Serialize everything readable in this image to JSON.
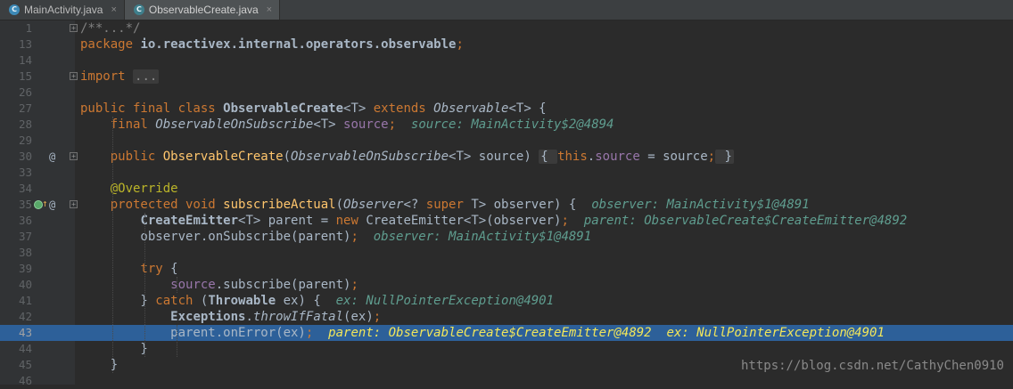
{
  "tabs": [
    {
      "label": "MainActivity.java",
      "icon": "c-class-icon",
      "close": "×",
      "active": false
    },
    {
      "label": "ObservableCreate.java",
      "icon": "c-class-icon",
      "close": "×",
      "active": true
    }
  ],
  "tab_icon_letter": "C",
  "lines": [
    {
      "n": "1",
      "tokens": [
        {
          "t": "/**...*/",
          "c": "cmt"
        }
      ]
    },
    {
      "n": "13",
      "tokens": [
        {
          "t": "package ",
          "c": "kw"
        },
        {
          "t": "io.reactivex.internal.operators.observable",
          "c": "bold"
        },
        {
          "t": ";",
          "c": "kw"
        }
      ]
    },
    {
      "n": "14",
      "tokens": []
    },
    {
      "n": "15",
      "tokens": [
        {
          "t": "import ",
          "c": "kw"
        },
        {
          "t": "...",
          "c": "fold-inline dim"
        }
      ]
    },
    {
      "n": "26",
      "tokens": []
    },
    {
      "n": "27",
      "tokens": [
        {
          "t": "public final class ",
          "c": "kw"
        },
        {
          "t": "ObservableCreate",
          "c": "bold"
        },
        {
          "t": "<T> "
        },
        {
          "t": "extends ",
          "c": "kw"
        },
        {
          "t": "Observable",
          "c": "it"
        },
        {
          "t": "<T> {"
        }
      ]
    },
    {
      "n": "28",
      "tokens": [
        {
          "t": "    "
        },
        {
          "t": "final ",
          "c": "kw"
        },
        {
          "t": "ObservableOnSubscribe",
          "c": "it"
        },
        {
          "t": "<T> "
        },
        {
          "t": "source",
          "c": "fld"
        },
        {
          "t": ";",
          "c": "kw"
        },
        {
          "t": "  source: MainActivity$2@4894",
          "c": "dbg"
        }
      ]
    },
    {
      "n": "29",
      "tokens": []
    },
    {
      "n": "30",
      "tokens": [
        {
          "t": "    "
        },
        {
          "t": "public ",
          "c": "kw"
        },
        {
          "t": "ObservableCreate",
          "c": "cls"
        },
        {
          "t": "("
        },
        {
          "t": "ObservableOnSubscribe",
          "c": "it"
        },
        {
          "t": "<T> source) "
        },
        {
          "t": "{ ",
          "c": "fold-inline"
        },
        {
          "t": "this",
          "c": "kw"
        },
        {
          "t": "."
        },
        {
          "t": "source",
          "c": "fld"
        },
        {
          "t": " = source"
        },
        {
          "t": ";",
          "c": "kw"
        },
        {
          "t": " }",
          "c": "fold-inline"
        }
      ]
    },
    {
      "n": "33",
      "tokens": []
    },
    {
      "n": "34",
      "tokens": [
        {
          "t": "    "
        },
        {
          "t": "@Override",
          "c": "ann"
        }
      ]
    },
    {
      "n": "35",
      "tokens": [
        {
          "t": "    "
        },
        {
          "t": "protected void ",
          "c": "kw"
        },
        {
          "t": "subscribeActual",
          "c": "cls"
        },
        {
          "t": "("
        },
        {
          "t": "Observer",
          "c": "it"
        },
        {
          "t": "<? "
        },
        {
          "t": "super ",
          "c": "kw"
        },
        {
          "t": "T> observer) {"
        },
        {
          "t": "  observer: MainActivity$1@4891",
          "c": "dbg"
        }
      ]
    },
    {
      "n": "36",
      "tokens": [
        {
          "t": "        "
        },
        {
          "t": "CreateEmitter",
          "c": "bold"
        },
        {
          "t": "<T> parent = "
        },
        {
          "t": "new ",
          "c": "kw"
        },
        {
          "t": "CreateEmitter<T>(observer)"
        },
        {
          "t": ";",
          "c": "kw"
        },
        {
          "t": "  parent: ObservableCreate$CreateEmitter@4892",
          "c": "dbg"
        }
      ]
    },
    {
      "n": "37",
      "tokens": [
        {
          "t": "        observer.onSubscribe(parent)"
        },
        {
          "t": ";",
          "c": "kw"
        },
        {
          "t": "  observer: MainActivity$1@4891",
          "c": "dbg"
        }
      ]
    },
    {
      "n": "38",
      "tokens": []
    },
    {
      "n": "39",
      "tokens": [
        {
          "t": "        "
        },
        {
          "t": "try ",
          "c": "kw"
        },
        {
          "t": "{"
        }
      ]
    },
    {
      "n": "40",
      "tokens": [
        {
          "t": "            "
        },
        {
          "t": "source",
          "c": "fld"
        },
        {
          "t": ".subscribe(parent)"
        },
        {
          "t": ";",
          "c": "kw"
        }
      ]
    },
    {
      "n": "41",
      "tokens": [
        {
          "t": "        } "
        },
        {
          "t": "catch ",
          "c": "kw"
        },
        {
          "t": "("
        },
        {
          "t": "Throwable",
          "c": "bold"
        },
        {
          "t": " ex) {"
        },
        {
          "t": "  ex: NullPointerException@4901",
          "c": "dbg"
        }
      ]
    },
    {
      "n": "42",
      "tokens": [
        {
          "t": "            "
        },
        {
          "t": "Exceptions",
          "c": "bold"
        },
        {
          "t": "."
        },
        {
          "t": "throwIfFatal",
          "c": "it"
        },
        {
          "t": "(ex)"
        },
        {
          "t": ";",
          "c": "kw"
        }
      ]
    },
    {
      "n": "43",
      "tokens": [
        {
          "t": "            parent.onError(ex)"
        },
        {
          "t": ";",
          "c": "kw"
        },
        {
          "t": "  parent: ObservableCreate$CreateEmitter@4892  ex: NullPointerException@4901",
          "c": "dbg"
        }
      ]
    },
    {
      "n": "44",
      "tokens": [
        {
          "t": "        }"
        }
      ]
    },
    {
      "n": "45",
      "tokens": [
        {
          "t": "    }"
        }
      ]
    },
    {
      "n": "46",
      "tokens": []
    }
  ],
  "current_line": "43",
  "gutter_marks": [
    {
      "line": "30",
      "text": "@",
      "icon": "implementation-icon"
    },
    {
      "line": "35",
      "text": "@",
      "icon": "override-icon"
    }
  ],
  "breakpoint_line": "35",
  "fold_lines": [
    "1",
    "15",
    "30",
    "35"
  ],
  "watermark": "https://blog.csdn.net/CathyChen0910",
  "colors": {
    "keyword": "#cc7832",
    "method": "#ffc66d",
    "field": "#9876aa",
    "annotation": "#bbb529",
    "debug_value": "#5f9d8f",
    "current_line": "#2d6099"
  }
}
